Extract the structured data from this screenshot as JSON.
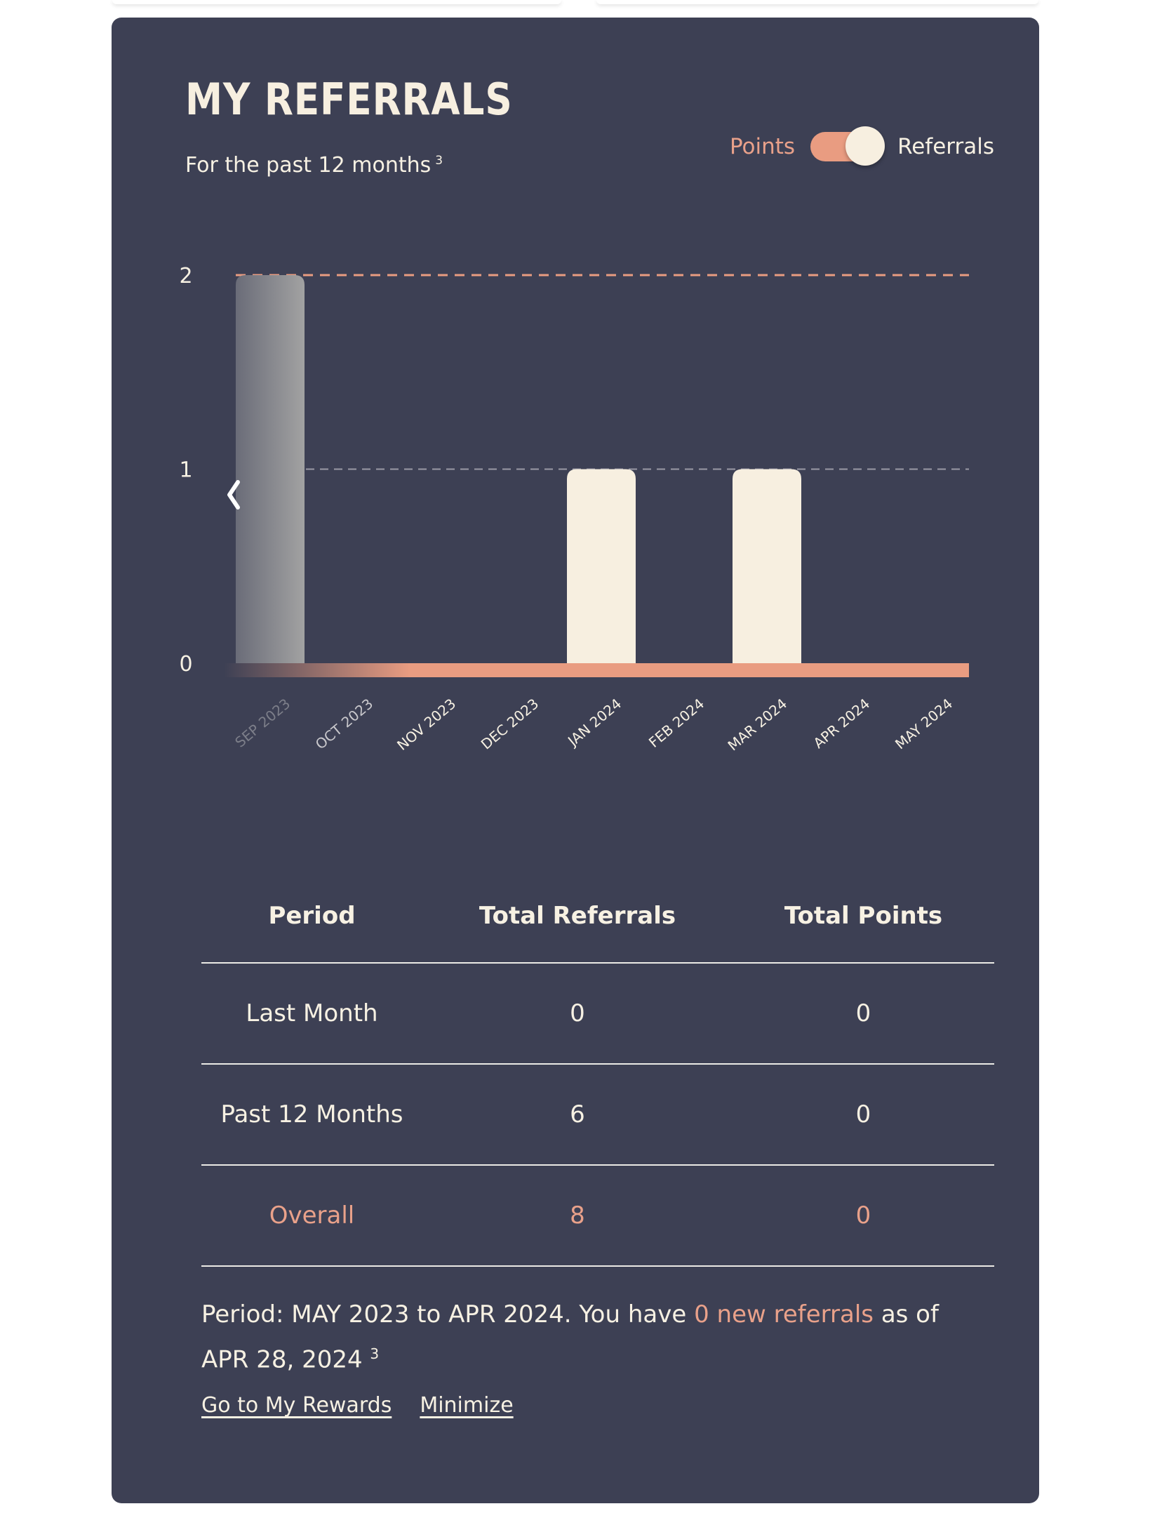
{
  "card": {
    "title": "MY REFERRALS",
    "subtitle": "For the past 12 months",
    "subtitle_footnote": "3"
  },
  "toggle": {
    "left_label": "Points",
    "right_label": "Referrals",
    "selected": "Referrals"
  },
  "colors": {
    "card_bg": "#3d4054",
    "accent": "#e9a18a",
    "cream": "#f7efe0",
    "text": "#f7f1e3"
  },
  "icons": {
    "prev": "chevron-left-icon"
  },
  "chart_data": {
    "type": "bar",
    "categories": [
      "SEP 2023",
      "OCT 2023",
      "NOV 2023",
      "DEC 2023",
      "JAN 2024",
      "FEB 2024",
      "MAR 2024",
      "APR 2024",
      "MAY 2024"
    ],
    "values": [
      2,
      0,
      0,
      0,
      1,
      0,
      1,
      0,
      0
    ],
    "yticks": [
      0,
      1,
      2
    ],
    "ylim": [
      0,
      2
    ],
    "reference_line": 2,
    "grid": true
  },
  "table": {
    "headers": [
      "Period",
      "Total Referrals",
      "Total Points"
    ],
    "rows": [
      [
        "Last Month",
        "0",
        "0"
      ],
      [
        "Past 12 Months",
        "6",
        "0"
      ],
      [
        "Overall",
        "8",
        "0"
      ]
    ]
  },
  "note": {
    "prefix": "Period: MAY 2023 to APR 2024. You have",
    "highlight": "0 new referrals",
    "suffix": "as of APR 28, 2024",
    "footnote": "3"
  },
  "links": {
    "rewards": "Go to My Rewards",
    "minimize": "Minimize"
  }
}
